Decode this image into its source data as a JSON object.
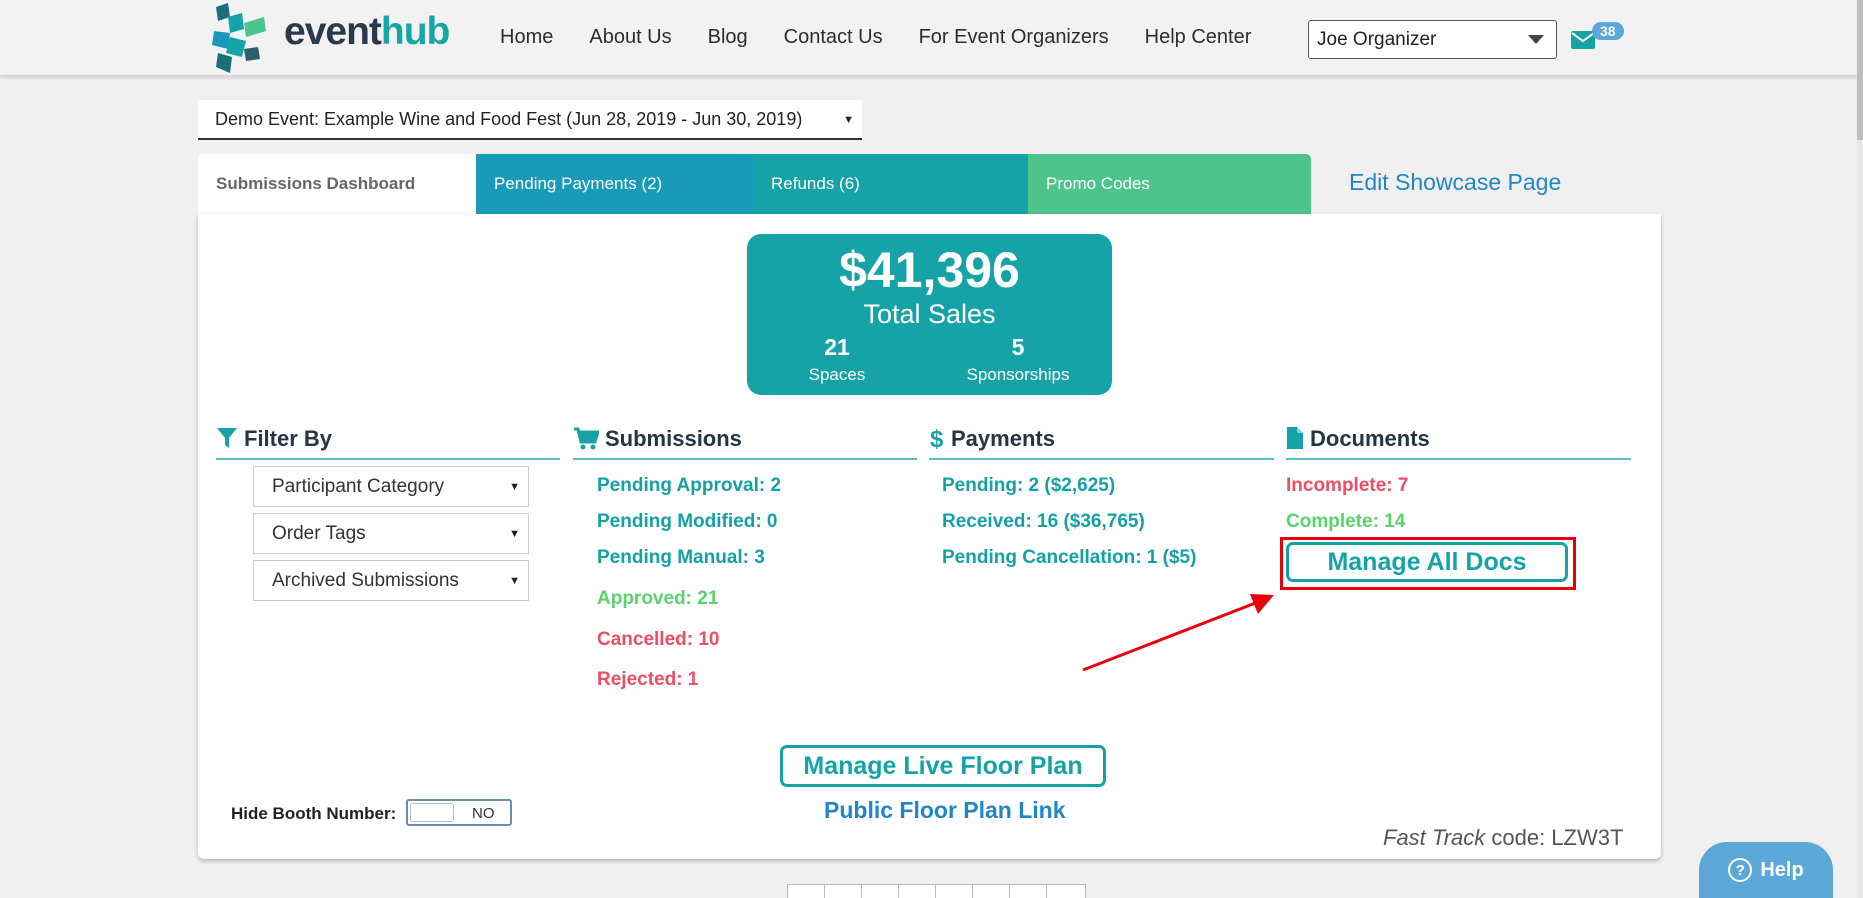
{
  "header": {
    "logo": {
      "part1": "event",
      "part2": "hub"
    },
    "nav": [
      "Home",
      "About Us",
      "Blog",
      "Contact Us",
      "For Event Organizers",
      "Help Center"
    ],
    "user": "Joe Organizer",
    "mail_count": "38"
  },
  "event_select": "Demo Event: Example Wine and Food Fest (Jun 28, 2019 - Jun 30, 2019)",
  "tabs": {
    "dashboard": "Submissions Dashboard",
    "pending": "Pending Payments (2)",
    "refunds": "Refunds (6)",
    "promo": "Promo Codes",
    "edit_showcase": "Edit Showcase Page"
  },
  "sales": {
    "amount": "$41,396",
    "label": "Total Sales",
    "spaces_count": "21",
    "spaces_label": "Spaces",
    "sponsorships_count": "5",
    "sponsorships_label": "Sponsorships"
  },
  "filter": {
    "heading": "Filter By",
    "selects": [
      "Participant Category",
      "Order Tags",
      "Archived Submissions"
    ]
  },
  "submissions": {
    "heading": "Submissions",
    "items": [
      "Pending Approval: 2",
      "Pending Modified: 0",
      "Pending Manual: 3",
      "Approved: 21",
      "Cancelled: 10",
      "Rejected: 1"
    ]
  },
  "payments": {
    "heading": "Payments",
    "items": [
      "Pending: 2 ($2,625)",
      "Received: 16 ($36,765)",
      "Pending Cancellation: 1 ($5)"
    ]
  },
  "documents": {
    "heading": "Documents",
    "incomplete": "Incomplete: 7",
    "complete": "Complete: 14",
    "manage_button": "Manage All Docs"
  },
  "floor": {
    "manage_button": "Manage Live Floor Plan",
    "public_link": "Public Floor Plan Link"
  },
  "hide_booth": {
    "label": "Hide Booth Number:",
    "state": "NO"
  },
  "fast_track": {
    "prefix": "Fast Track",
    "code_text": " code: LZW3T"
  },
  "help_button": "Help",
  "colors": {
    "teal": "#16a3a8",
    "blue": "#1a9ab9",
    "green": "#4cc48b",
    "red": "#ee4d63",
    "highlight": "#e8000b"
  }
}
